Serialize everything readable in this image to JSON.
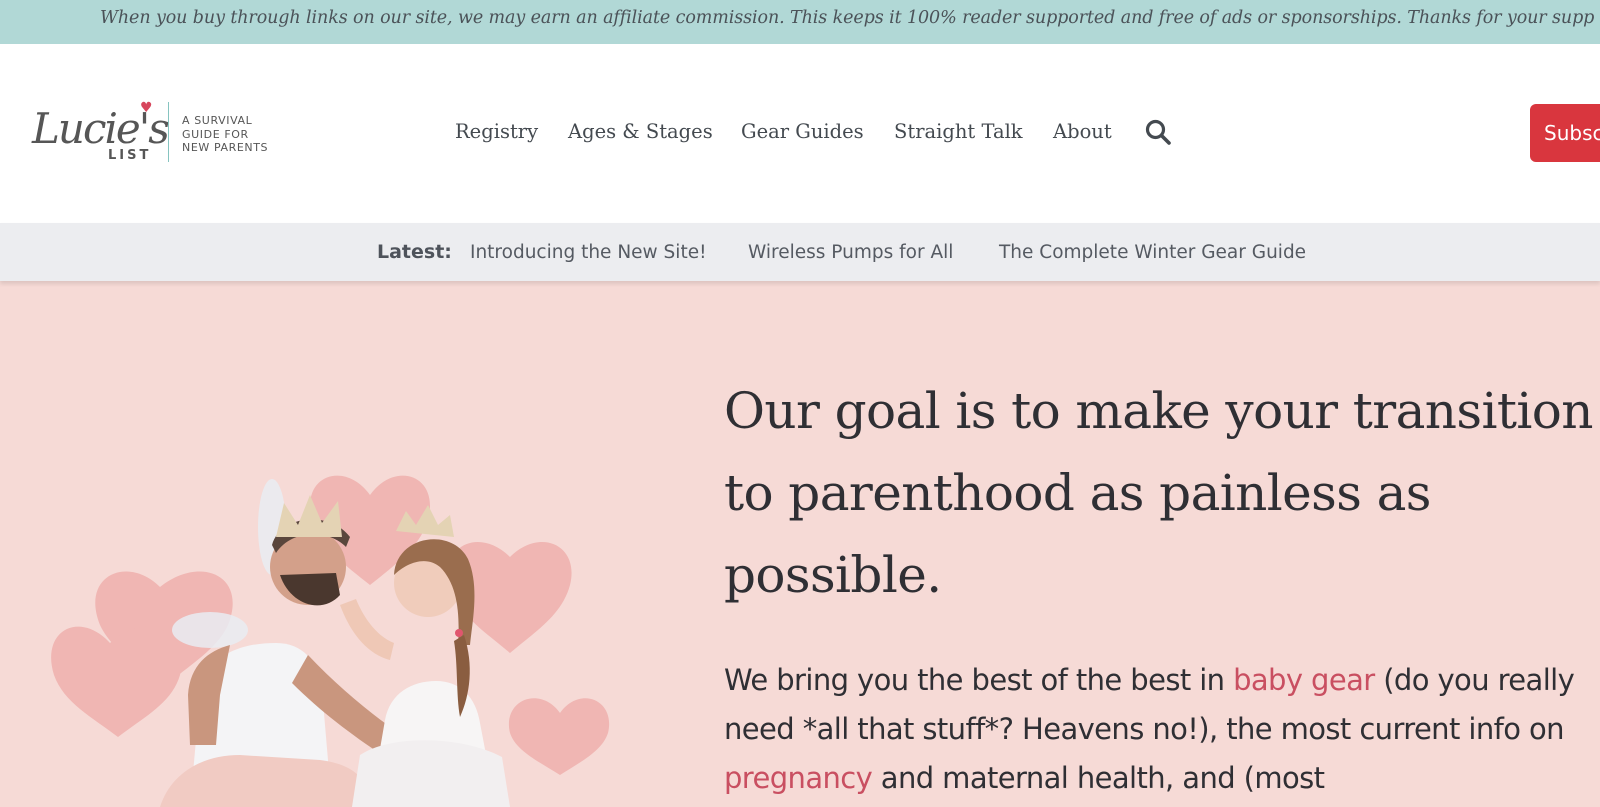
{
  "banner": {
    "text": "When you buy through links on our site, we may earn an affiliate commission. This keeps it 100% reader supported and free of ads or sponsorships. Thanks for your supp"
  },
  "logo": {
    "script": "Lucie's",
    "list": "LIST",
    "tagline": [
      "A SURVIVAL",
      "GUIDE FOR",
      "NEW PARENTS"
    ]
  },
  "nav": {
    "items": [
      "Registry",
      "Ages & Stages",
      "Gear Guides",
      "Straight Talk",
      "About"
    ],
    "search_icon": "search-icon",
    "subscribe_label": "Subsc"
  },
  "latest": {
    "label": "Latest:",
    "links": [
      "Introducing the New Site!",
      "Wireless Pumps for All",
      "The Complete Winter Gear Guide"
    ]
  },
  "hero": {
    "title": "Our goal is to make your transition to parenthood as painless as possible.",
    "body": {
      "p1": "We bring you the best of the best in ",
      "link1": "baby gear",
      "p2": " (do you really need *all that stuff*? Heavens no!), the most current info on ",
      "link2": "pregnancy",
      "p3": " and maternal health, and (most"
    }
  },
  "colors": {
    "banner_bg": "#b1d8d6",
    "hero_bg": "#f6dad6",
    "accent_red": "#d9363e",
    "link_pink": "#c94f61"
  }
}
